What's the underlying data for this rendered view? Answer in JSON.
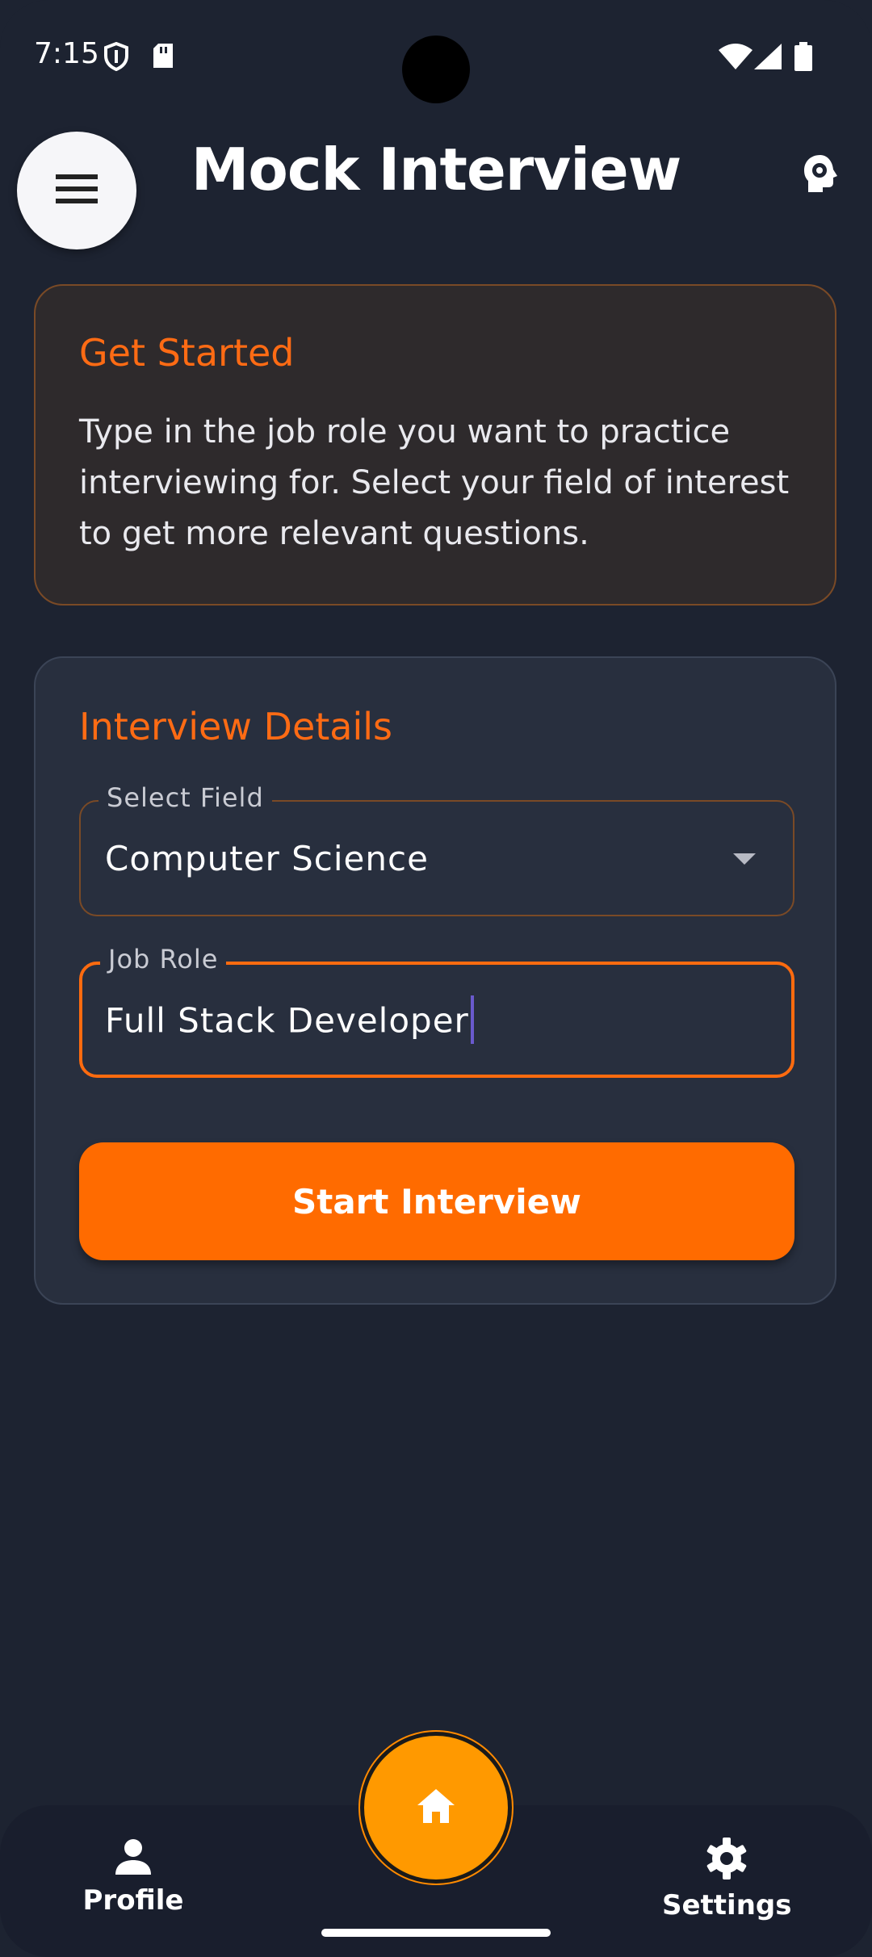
{
  "status_bar": {
    "time": "7:15"
  },
  "header": {
    "title": "Mock Interview"
  },
  "info_card": {
    "title": "Get Started",
    "text": "Type in the job role you want to practice interviewing for. Select your field of interest to get more relevant questions."
  },
  "details": {
    "title": "Interview Details",
    "field_select": {
      "label": "Select Field",
      "value": "Computer Science"
    },
    "job_role": {
      "label": "Job Role",
      "value": "Full Stack Developer"
    },
    "start_label": "Start Interview"
  },
  "nav": {
    "profile_label": "Profile",
    "settings_label": "Settings"
  },
  "colors": {
    "accent": "#ff6b00",
    "home": "#ff9900",
    "background": "#1d2331"
  },
  "icons": [
    "menu-icon",
    "brain-gear-icon",
    "home-icon",
    "person-icon",
    "gear-icon",
    "shield-icon",
    "sd-card-icon",
    "wifi-icon",
    "signal-icon",
    "battery-icon"
  ]
}
